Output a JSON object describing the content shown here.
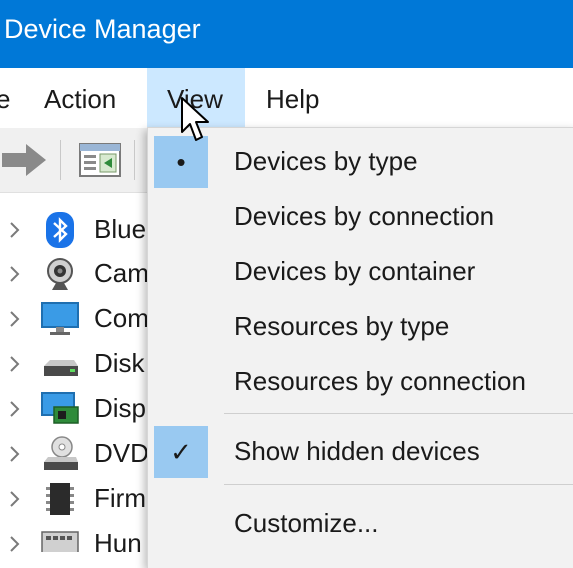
{
  "window": {
    "title": "Device Manager"
  },
  "menubar": {
    "items": [
      {
        "label": "e",
        "active": false
      },
      {
        "label": "Action",
        "active": false
      },
      {
        "label": "View",
        "active": true
      },
      {
        "label": "Help",
        "active": false
      }
    ]
  },
  "toolbar": {
    "buttons": [
      {
        "icon": "forward-arrow-icon"
      },
      {
        "icon": "show-hide-console-tree-icon"
      }
    ]
  },
  "tree": {
    "items": [
      {
        "label": "Blue",
        "icon": "bluetooth-icon"
      },
      {
        "label": "Cam",
        "icon": "camera-icon"
      },
      {
        "label": "Com",
        "icon": "computer-monitor-icon"
      },
      {
        "label": "Disk",
        "icon": "disk-drive-icon"
      },
      {
        "label": "Disp",
        "icon": "display-adapter-icon"
      },
      {
        "label": "DVD",
        "icon": "dvd-drive-icon"
      },
      {
        "label": "Firm",
        "icon": "firmware-chip-icon"
      },
      {
        "label": "Hun",
        "icon": "human-interface-icon"
      }
    ]
  },
  "view_menu": {
    "items": [
      {
        "label": "Devices by type",
        "mark": "•",
        "checked": true
      },
      {
        "label": "Devices by connection",
        "mark": "",
        "checked": false
      },
      {
        "label": "Devices by container",
        "mark": "",
        "checked": false
      },
      {
        "label": "Resources by type",
        "mark": "",
        "checked": false
      },
      {
        "label": "Resources by connection",
        "mark": "",
        "checked": false
      },
      {
        "label": "Show hidden devices",
        "mark": "✓",
        "checked": true
      },
      {
        "label": "Customize...",
        "mark": "",
        "checked": false
      }
    ]
  },
  "colors": {
    "titlebar": "#0078d7",
    "menu_active": "#cce8ff",
    "check_bg": "#99c9f1",
    "bluetooth": "#1a73e8"
  }
}
